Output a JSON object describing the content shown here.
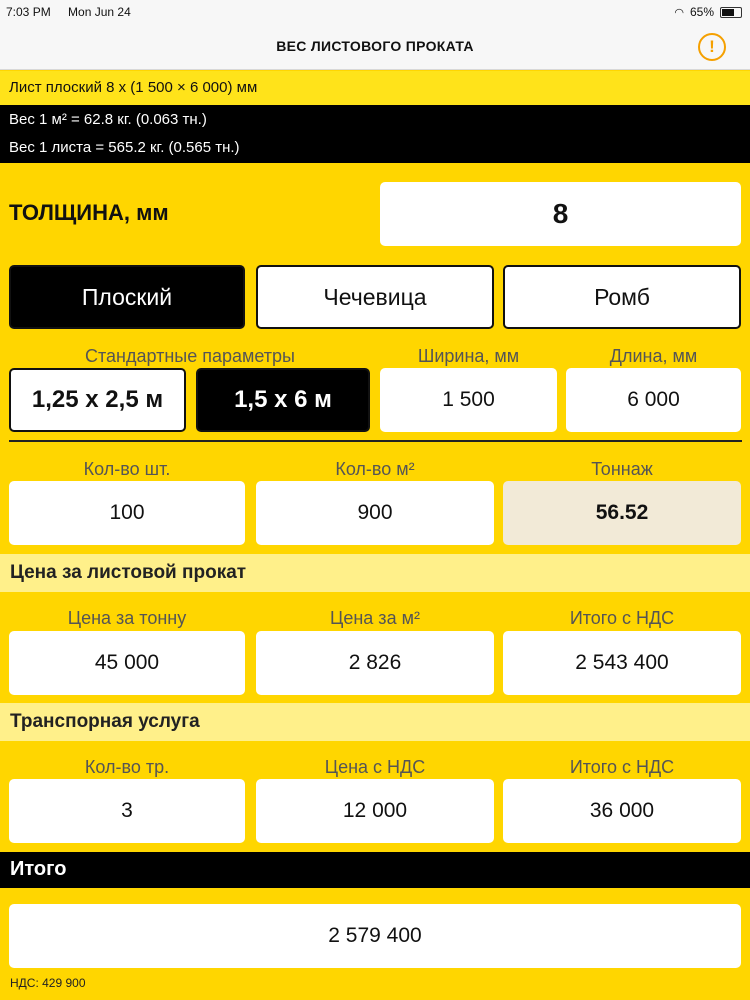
{
  "status_bar": {
    "time": "7:03 PM",
    "date": "Mon Jun 24",
    "battery": "65%"
  },
  "nav": {
    "title": "ВЕС ЛИСТОВОГО ПРОКАТА",
    "warning_icon": "exclamation-circle-icon",
    "warning_glyph": "!"
  },
  "info": {
    "title": "Лист плоский 8 x (1 500 × 6 000) мм",
    "weight_m2": "Вес 1 м² = 62.8 кг. (0.063 тн.)",
    "weight_sheet": "Вес 1 листа = 565.2 кг. (0.565 тн.)"
  },
  "thickness": {
    "label": "ТОЛЩИНА, мм",
    "value": "8"
  },
  "type_buttons": [
    "Плоский",
    "Чечевица",
    "Ромб"
  ],
  "params": {
    "standard_label": "Стандартные  параметры",
    "std1": "1,25 x 2,5 м",
    "std2": "1,5 x 6 м",
    "width_label": "Ширина, мм",
    "width_value": "1 500",
    "length_label": "Длина, мм",
    "length_value": "6 000"
  },
  "quantity": {
    "pcs_label": "Кол-во шт.",
    "pcs_value": "100",
    "m2_label": "Кол-во м²",
    "m2_value": "900",
    "tonnage_label": "Тоннаж",
    "tonnage_value": "56.52"
  },
  "price_section": {
    "title": "Цена за листовой прокат",
    "per_ton_label": "Цена за тонну",
    "per_ton_value": "45 000",
    "per_m2_label": "Цена за м²",
    "per_m2_value": "2 826",
    "total_label": "Итого с НДС",
    "total_value": "2 543 400"
  },
  "transport_section": {
    "title": "Транспорная услуга",
    "count_label": "Кол-во тр.",
    "count_value": "3",
    "price_label": "Цена с НДС",
    "price_value": "12 000",
    "total_label": "Итого с НДС",
    "total_value": "36 000"
  },
  "total": {
    "title": "Итого",
    "value": "2 579 400",
    "nds": "НДС: 429 900"
  },
  "colors": {
    "accent": "#FFD600",
    "selected": "#000000",
    "warning": "#F5A000"
  }
}
